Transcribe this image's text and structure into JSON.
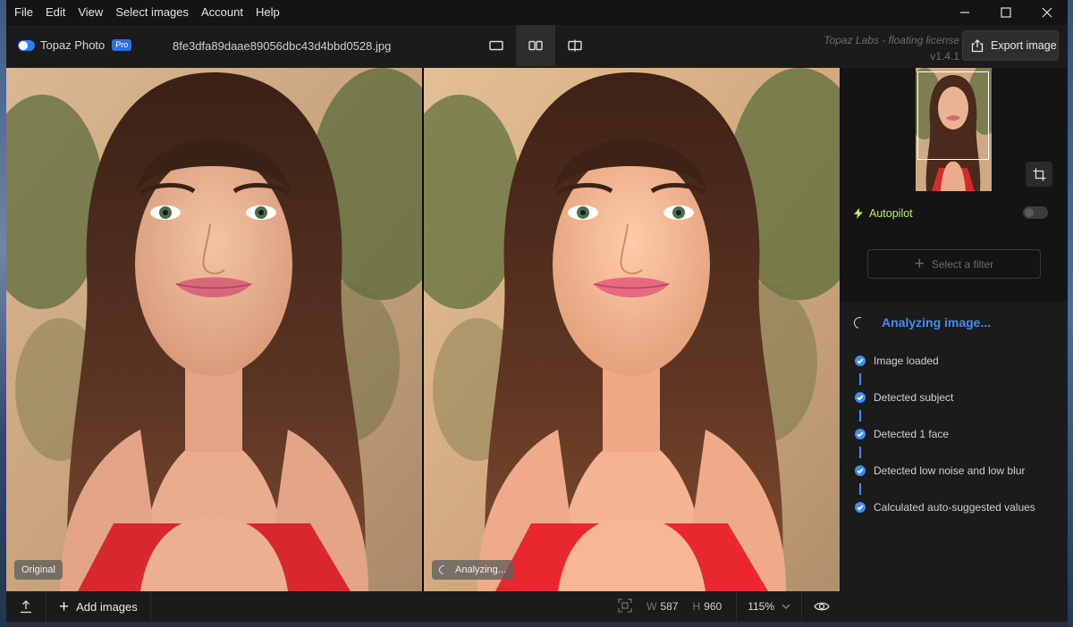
{
  "menu": {
    "items": [
      "File",
      "Edit",
      "View",
      "Select images",
      "Account",
      "Help"
    ]
  },
  "header": {
    "brand_name": "Topaz Photo",
    "brand_badge": "Pro",
    "filename": "8fe3dfa89daae89056dbc43d4bbd0528.jpg",
    "license_name": "Topaz Labs - floating license",
    "version": "v1.4.1",
    "export_label": "Export image"
  },
  "panes": {
    "original_label": "Original",
    "processed_label": "Analyzing..."
  },
  "bottombar": {
    "add_images_label": "Add images",
    "width_label": "W",
    "width_value": "587",
    "height_label": "H",
    "height_value": "960",
    "zoom": "115%"
  },
  "panel": {
    "autopilot_label": "Autopilot",
    "autopilot_on": false,
    "filter_placeholder": "Select a filter",
    "analysis_title": "Analyzing image...",
    "steps": [
      "Image loaded",
      "Detected subject",
      "Detected 1 face",
      "Detected low noise and low blur",
      "Calculated auto-suggested values"
    ]
  },
  "colors": {
    "accent": "#3f8df5",
    "autopilot": "#b9f25f",
    "brand_toggle": "#2f7cf6"
  }
}
